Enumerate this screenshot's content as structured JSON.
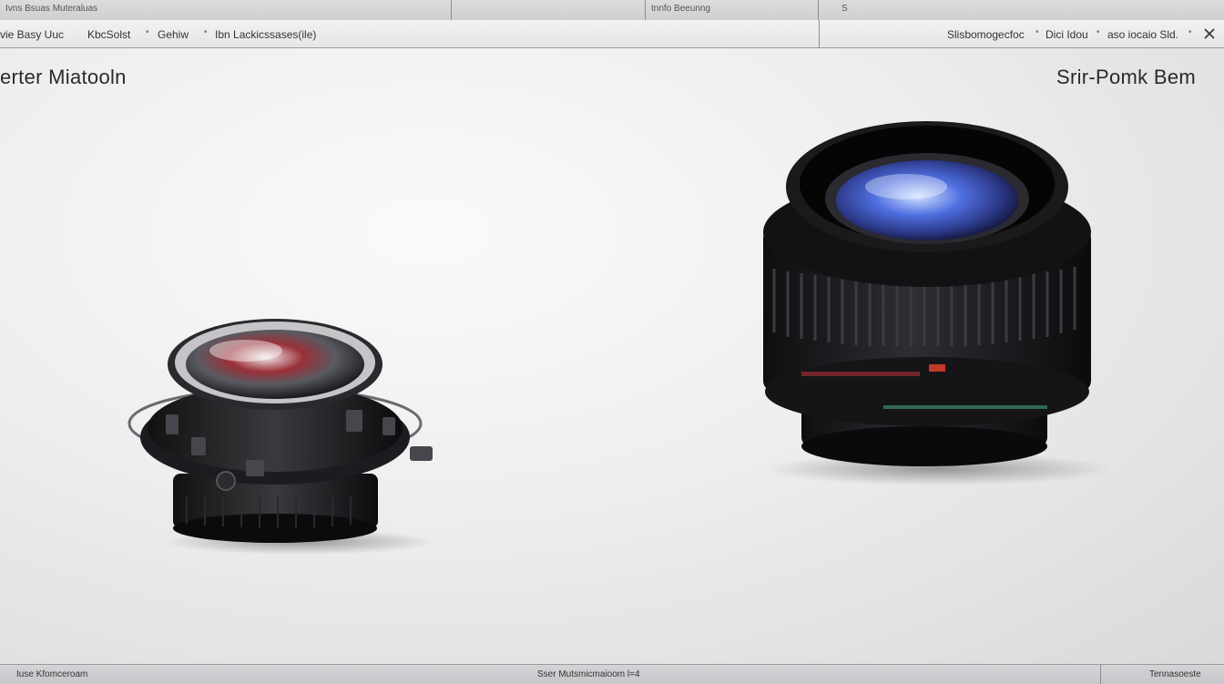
{
  "top_strip": {
    "left_text": "Ivns Bsuas Muteraluas",
    "center_text": "tnnfo Beeunng",
    "right_text": "S"
  },
  "toolbar": {
    "left_items": [
      "vie Basy Uuc",
      "KbcSolst",
      "Gehiw",
      "Ibn Lackicssases(ile)"
    ],
    "right_items": [
      "Slisbomogecfoc",
      "Dici Idou",
      "aso iocaio Sld."
    ]
  },
  "panels": {
    "left_title": "erter Miatooln",
    "right_title": "Srir-Pomk  Bem"
  },
  "status_bar": {
    "left": "Iuse Kfomceroam",
    "center": "Sser Mutsmicmaioom l=4",
    "right": "Tennasoeste"
  },
  "colors": {
    "background": "#e8e8ea",
    "lens_body": "#1a1a1c",
    "lens_glass_blue": "#4f6fe0",
    "lens_glass_red": "#9a3038"
  },
  "icons": [
    "close-icon",
    "lens-image-small",
    "lens-image-large"
  ]
}
